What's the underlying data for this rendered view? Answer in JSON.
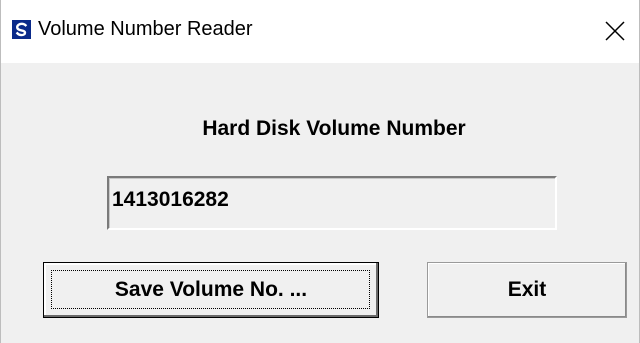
{
  "window": {
    "title": "Volume Number Reader",
    "app_icon": "app-logo-icon",
    "close_icon": "close-icon"
  },
  "main": {
    "heading": "Hard Disk Volume Number",
    "volume_value": "1413016282"
  },
  "buttons": {
    "save_label": "Save Volume No. ...",
    "exit_label": "Exit"
  },
  "colors": {
    "window_bg": "#f0f0f0",
    "titlebar_bg": "#ffffff",
    "app_icon_bg": "#0a2a8a"
  }
}
